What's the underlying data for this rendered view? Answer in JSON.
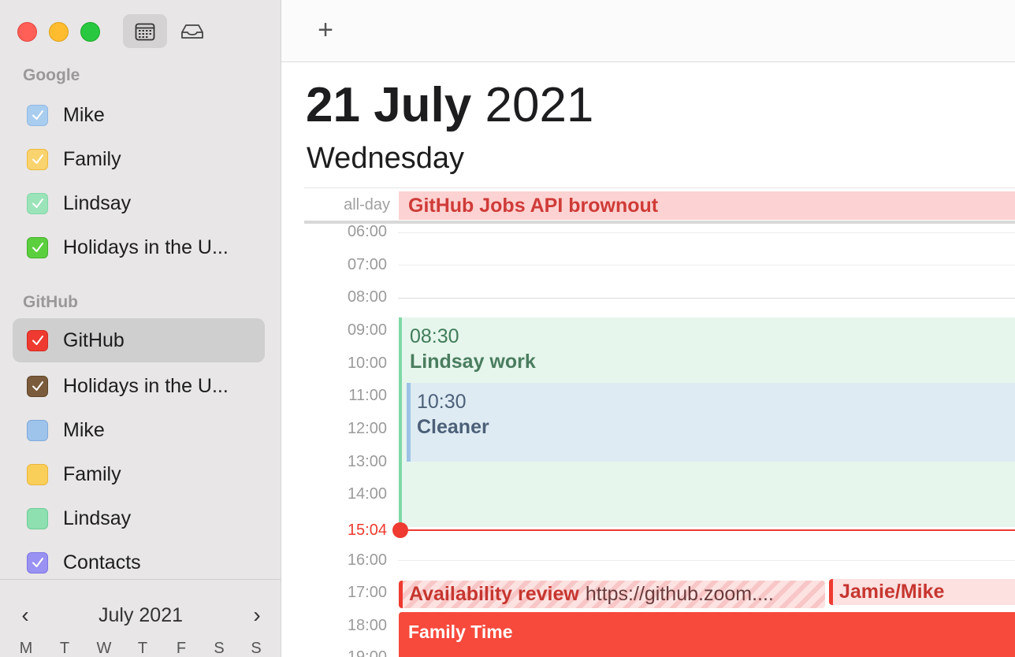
{
  "sidebar": {
    "groups": [
      {
        "title": "Google",
        "items": [
          {
            "label": "Mike",
            "color": "#8fb8e6",
            "checked": true
          },
          {
            "label": "Family",
            "color": "#f8c746",
            "checked": true
          },
          {
            "label": "Lindsay",
            "color": "#7fd8a6",
            "checked": true
          },
          {
            "label": "Holidays in the U...",
            "color": "#4fc737",
            "checked": true
          }
        ]
      },
      {
        "title": "GitHub",
        "items": [
          {
            "label": "GitHub",
            "color": "#ee3a30",
            "checked": true,
            "selected": true
          },
          {
            "label": "Holidays in the U...",
            "color": "#7a5b3c",
            "checked": true
          },
          {
            "label": "Mike",
            "color": "#8fb8e6",
            "checked": false
          },
          {
            "label": "Family",
            "color": "#f8c746",
            "checked": false
          },
          {
            "label": "Lindsay",
            "color": "#7fd8a6",
            "checked": false
          },
          {
            "label": "Contacts",
            "color": "#8d86ef",
            "checked": true
          }
        ]
      }
    ],
    "mini_calendar": {
      "title": "July 2021",
      "prev": "‹",
      "next": "›",
      "weekdays": [
        "M",
        "T",
        "W",
        "T",
        "F",
        "S",
        "S"
      ]
    }
  },
  "toolbar": {
    "add_label": "+"
  },
  "header": {
    "day_month": "21 July",
    "year": "2021",
    "weekday": "Wednesday"
  },
  "allday": {
    "label": "all-day",
    "event": "GitHub Jobs API brownout"
  },
  "time_labels": [
    "06:00",
    "07:00",
    "08:00",
    "09:00",
    "10:00",
    "11:00",
    "12:00",
    "13:00",
    "14:00",
    "16:00",
    "17:00",
    "18:00",
    "19:00"
  ],
  "now": "15:04",
  "events": {
    "lindsay": {
      "time": "08:30",
      "title": "Lindsay work"
    },
    "cleaner": {
      "time": "10:30",
      "title": "Cleaner"
    },
    "availability": {
      "title": "Availability review",
      "url": "https://github.zoom...."
    },
    "jamie": {
      "title": "Jamie/Mike"
    },
    "family": {
      "title": "Family Time"
    }
  },
  "colors": {
    "accent_red": "#ee3a30",
    "sidebar_bg": "#e8e6e6"
  }
}
